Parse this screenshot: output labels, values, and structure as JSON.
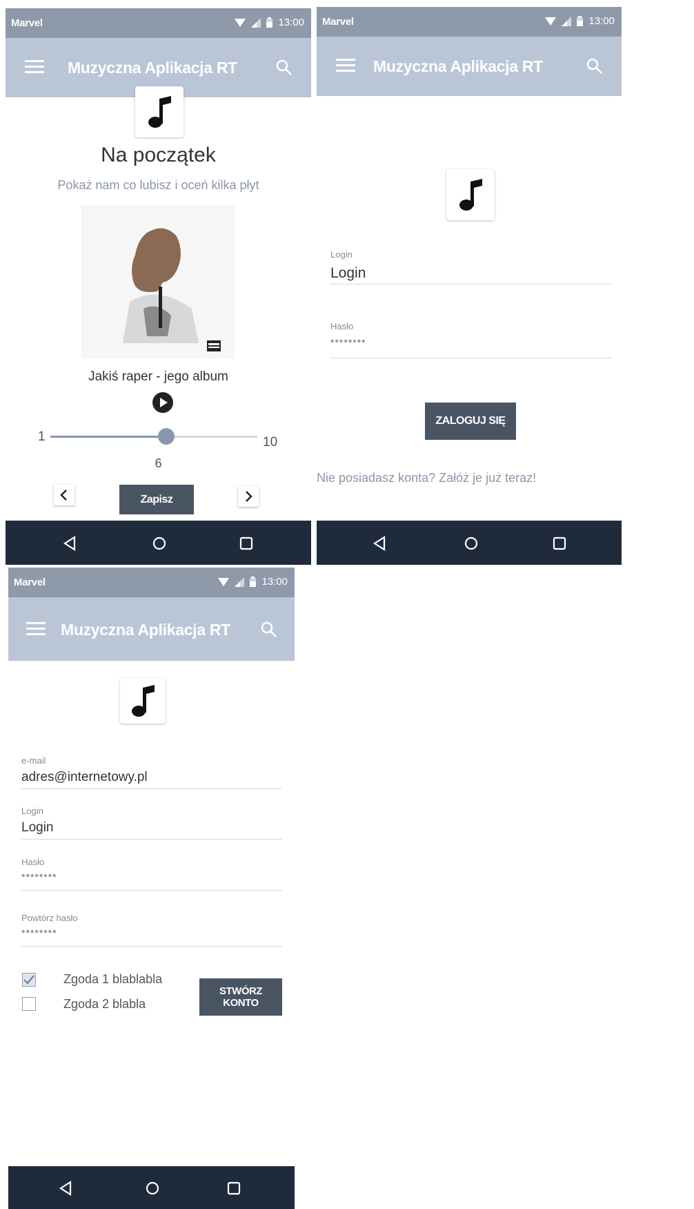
{
  "status": {
    "carrier": "Marvel",
    "time": "13:00"
  },
  "app": {
    "title": "Muzyczna Aplikacja RT"
  },
  "colors": {
    "statusbar": "#8e9aaa",
    "appbar": "#bac6d6",
    "navbar": "#1f2b3b",
    "button": "#4a5564",
    "slider": "#8797ae"
  },
  "screen1": {
    "heading": "Na początek",
    "subtitle": "Pokaż nam co lubisz i oceń kilka płyt",
    "album_caption": "Jakiś raper - jego album",
    "rating": {
      "min": "1",
      "max": "10",
      "value": "6",
      "fraction": 0.56
    },
    "save_label": "Zapisz"
  },
  "screen2": {
    "login_label": "Login",
    "login_value": "Login",
    "password_label": "Hasło",
    "password_value": "********",
    "login_button": "ZALOGUJ SIĘ",
    "register_prompt": "Nie posiadasz konta? Załóż je już teraz!"
  },
  "screen3": {
    "email_label": "e-mail",
    "email_value": "adres@internetowy.pl",
    "login_label": "Login",
    "login_value": "Login",
    "password_label": "Hasło",
    "password_value": "********",
    "repeat_label": "Powtórz hasło",
    "repeat_value": "********",
    "consent1": "Zgoda 1 blablabla",
    "consent1_checked": true,
    "consent2": "Zgoda 2 blabla",
    "consent2_checked": false,
    "create_line1": "STWÓRZ",
    "create_line2": "KONTO"
  }
}
